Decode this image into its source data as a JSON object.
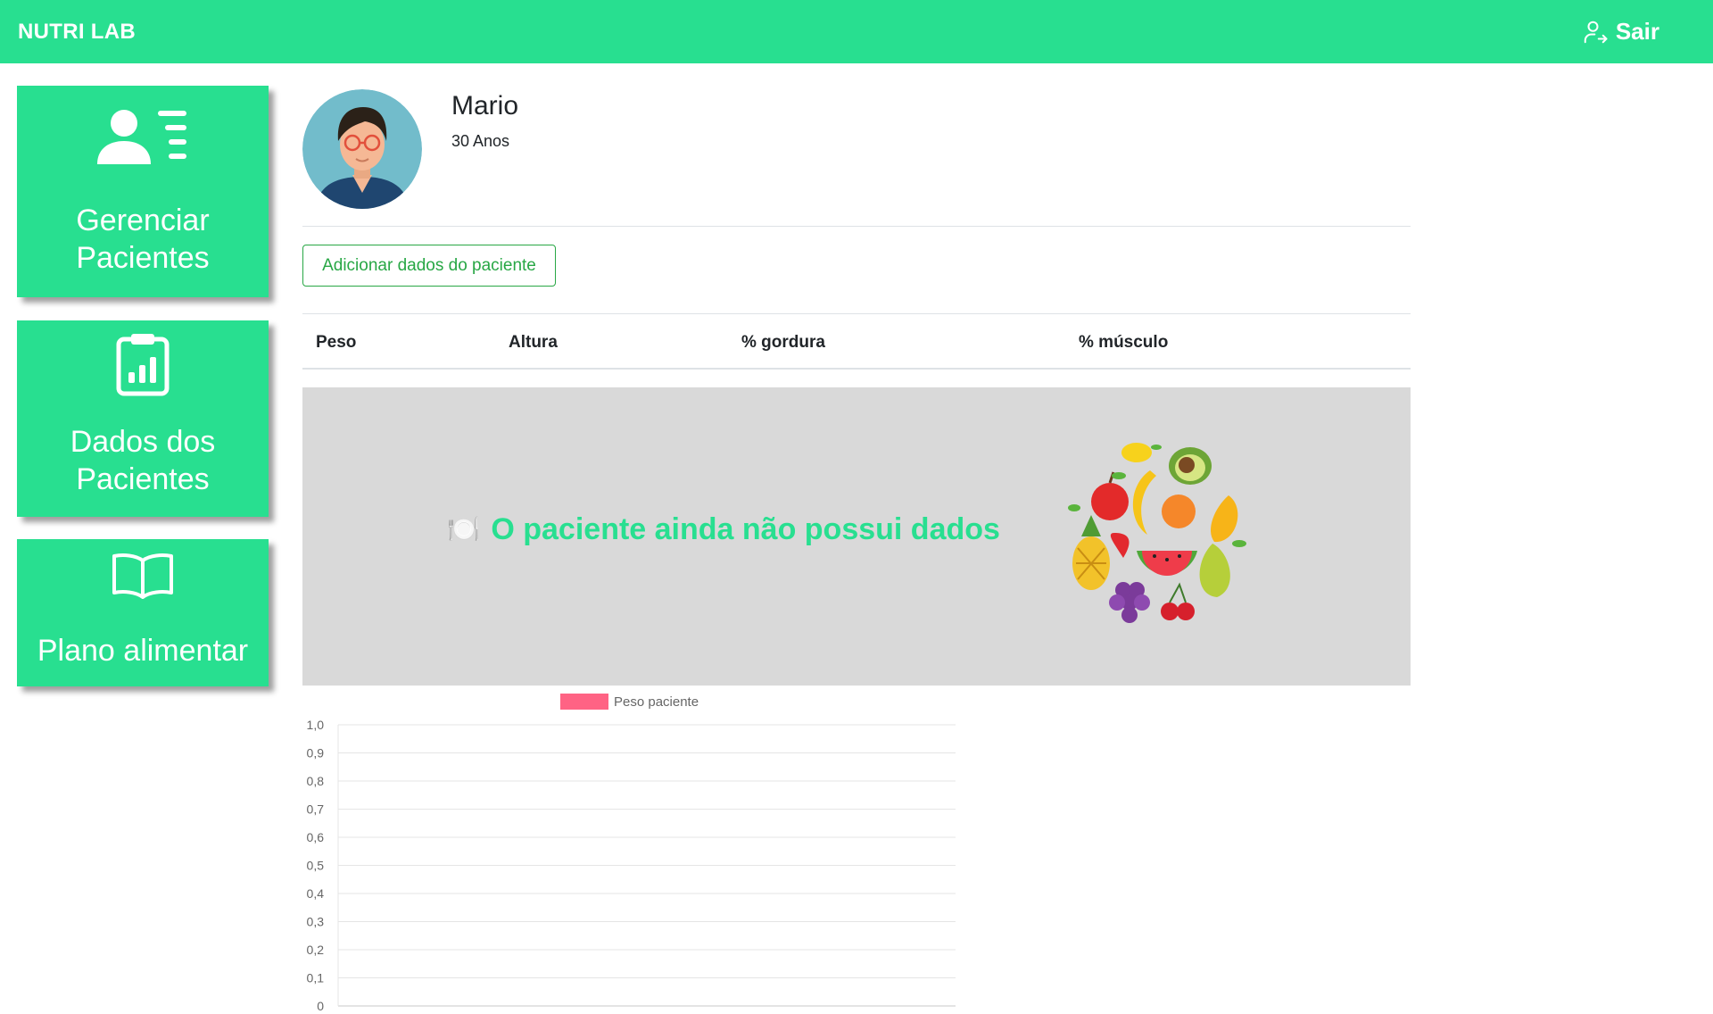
{
  "app": {
    "brand": "NUTRI LAB",
    "logout_label": "Sair",
    "accent": "#28df90"
  },
  "sidebar": {
    "items": [
      {
        "label_line1": "Gerenciar",
        "label_line2": "Pacientes",
        "icon": "user-list-icon"
      },
      {
        "label_line1": "Dados dos",
        "label_line2": "Pacientes",
        "icon": "clipboard-chart-icon"
      },
      {
        "label_line1": "Plano alimentar",
        "label_line2": "",
        "icon": "open-book-icon"
      }
    ]
  },
  "patient": {
    "name": "Mario",
    "age": "30 Anos"
  },
  "actions": {
    "add_data_label": "Adicionar dados do paciente"
  },
  "table": {
    "headers": [
      "Peso",
      "Altura",
      "% gordura",
      "% músculo"
    ]
  },
  "empty_state": {
    "icon": "🍽️",
    "message": "O paciente ainda não possui dados"
  },
  "chart_data": {
    "type": "line",
    "series": [
      {
        "name": "Peso paciente",
        "values": [],
        "color": "#ff6384"
      }
    ],
    "x": [],
    "ylim": [
      0,
      1
    ],
    "yticks": [
      "0",
      "0,1",
      "0,2",
      "0,3",
      "0,4",
      "0,5",
      "0,6",
      "0,7",
      "0,8",
      "0,9",
      "1,0"
    ],
    "grid": true,
    "legend": "top"
  }
}
